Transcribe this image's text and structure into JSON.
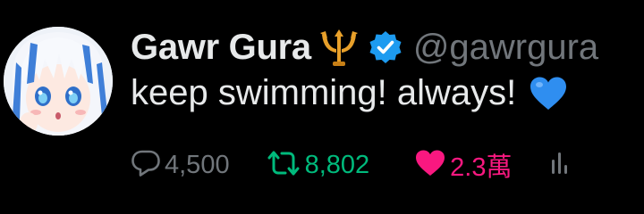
{
  "tweet": {
    "display_name": "Gawr Gura",
    "handle": "@gawrgura",
    "text": "keep swimming! always!",
    "name_icons": [
      "trident-icon",
      "verified-icon"
    ],
    "text_emoji": "blue-heart-icon",
    "actions": {
      "reply_count": "4,500",
      "retweet_count": "8,802",
      "like_count": "2.3萬",
      "views_icon": "views-bar-icon"
    }
  },
  "colors": {
    "background": "#000000",
    "text_primary": "#e7e9ea",
    "text_secondary": "#71767b",
    "verified_blue": "#1d9bf0",
    "retweet_green": "#00ba7c",
    "like_pink": "#f91880",
    "trident_gold": "#e8a02a"
  }
}
